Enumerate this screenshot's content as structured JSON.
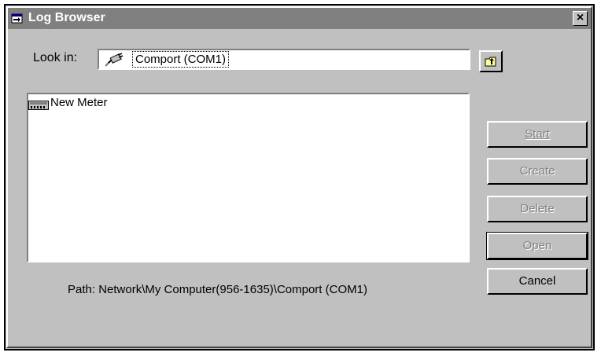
{
  "window": {
    "title": "Log Browser",
    "close_label": "×"
  },
  "lookin": {
    "label": "Look in:",
    "value": "Comport (COM1)"
  },
  "file_list": {
    "items": [
      {
        "label": "New Meter",
        "icon": "meter-icon"
      }
    ]
  },
  "buttons": {
    "start": {
      "label": "Start",
      "enabled": false
    },
    "create": {
      "label": "Create",
      "enabled": false
    },
    "delete": {
      "label": "Delete",
      "enabled": false
    },
    "open": {
      "label": "Open",
      "enabled": false
    },
    "cancel": {
      "label": "Cancel",
      "enabled": true
    }
  },
  "path": {
    "text": "Path: Network\\My Computer(956-1635)\\Comport (COM1)"
  },
  "colors": {
    "titlebar": "#808080",
    "face": "#c0c0c0"
  }
}
